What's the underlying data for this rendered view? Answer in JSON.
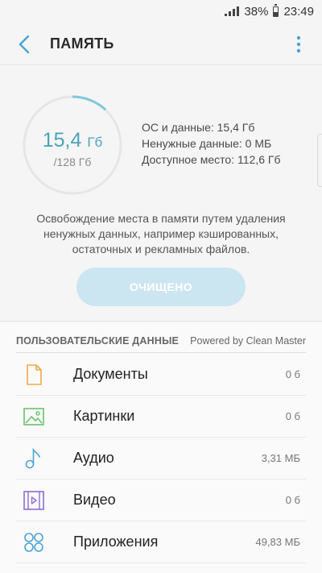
{
  "status_bar": {
    "battery": "38%",
    "time": "23:49"
  },
  "header": {
    "title": "ПАМЯТЬ"
  },
  "storage": {
    "used_value": "15,4",
    "used_unit": "Гб",
    "total": "/128 Гб",
    "used_fraction": 0.12,
    "os_and_data": "ОС и данные: 15,4 Гб",
    "junk": "Ненужные данные: 0 МБ",
    "available": "Доступное место: 112,6 Гб"
  },
  "description": "Освобождение места в памяти путем удаления ненужных данных, например кэшированных, остаточных и рекламных файлов.",
  "clean_button": "ОЧИЩЕНО",
  "user_data": {
    "title": "ПОЛЬЗОВАТЕЛЬСКИЕ ДАННЫЕ",
    "powered_by": "Powered by Clean Master",
    "items": [
      {
        "icon": "document-icon",
        "label": "Документы",
        "size": "0 б",
        "color": "#f0a94a"
      },
      {
        "icon": "image-icon",
        "label": "Картинки",
        "size": "0 б",
        "color": "#6cc16c"
      },
      {
        "icon": "music-note-icon",
        "label": "Аудио",
        "size": "3,31 МБ",
        "color": "#4aa3d6"
      },
      {
        "icon": "video-icon",
        "label": "Видео",
        "size": "0 б",
        "color": "#8c6fd1"
      },
      {
        "icon": "apps-icon",
        "label": "Приложения",
        "size": "49,83 МБ",
        "color": "#4aa3d6"
      }
    ]
  },
  "colors": {
    "accent": "#4da3b8",
    "ring_track": "#e6e6e6",
    "ring_fill": "#7ec8dc"
  }
}
